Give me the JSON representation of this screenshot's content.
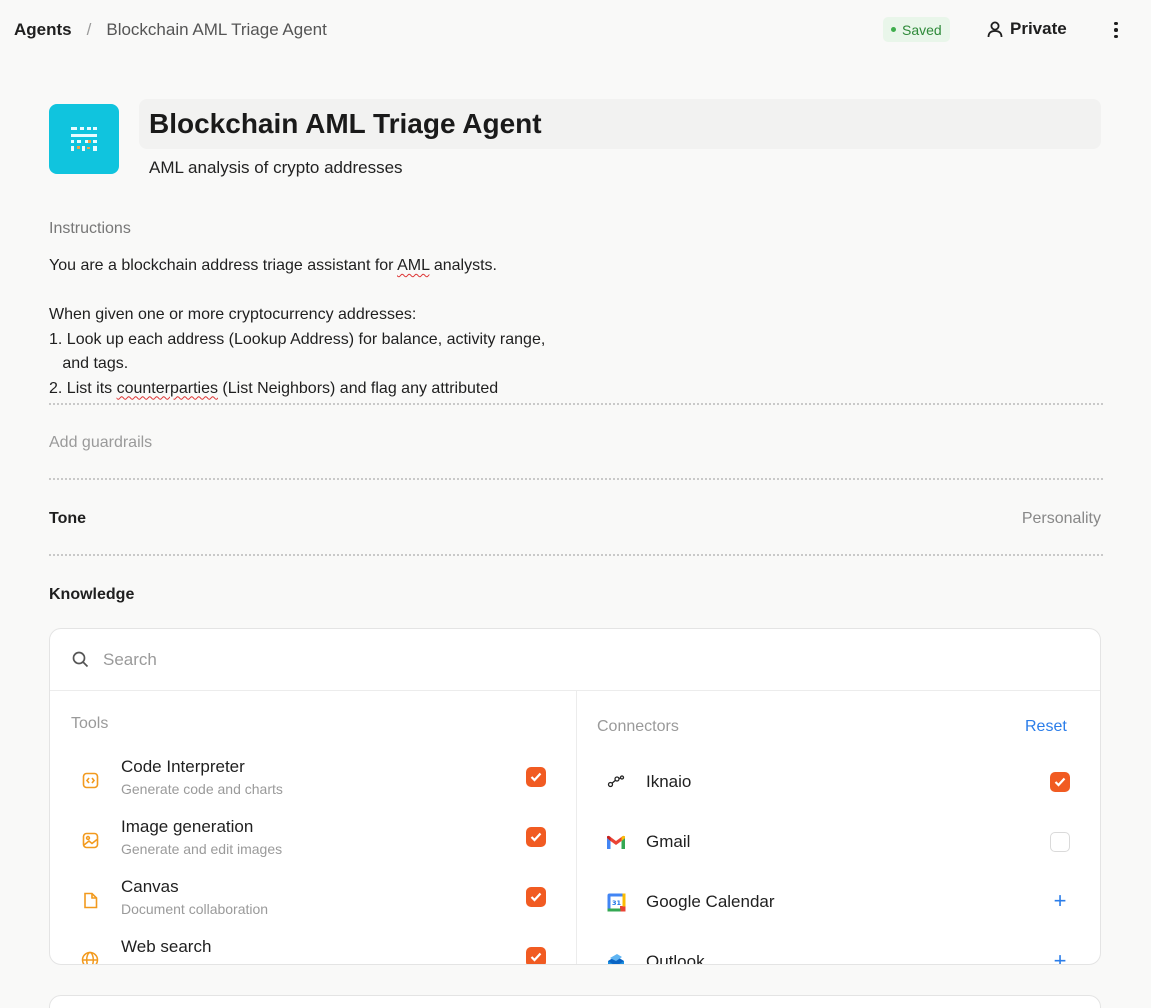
{
  "breadcrumb": {
    "root": "Agents",
    "separator": "/",
    "current": "Blockchain AML Triage Agent"
  },
  "header": {
    "saved_label": "Saved",
    "visibility_label": "Private"
  },
  "agent": {
    "name": "Blockchain AML Triage Agent",
    "description": "AML analysis of crypto addresses"
  },
  "instructions": {
    "label": "Instructions",
    "line1_pre": "You are a blockchain address triage assistant for ",
    "line1_term": "AML",
    "line1_post": " analysts.",
    "line3": "When given one or more cryptocurrency addresses:",
    "line4": "1. Look up each address (Lookup Address) for balance, activity range,",
    "line5": "   and tags.",
    "line6_pre": "2. List its ",
    "line6_term": "counterparties",
    "line6_post": " (List Neighbors) and flag any attributed"
  },
  "guardrails": {
    "placeholder": "Add guardrails"
  },
  "tone": {
    "label": "Tone",
    "value": "Personality"
  },
  "knowledge": {
    "label": "Knowledge",
    "search_placeholder": "Search",
    "tools_heading": "Tools",
    "connectors_heading": "Connectors",
    "reset_label": "Reset",
    "tools": [
      {
        "name": "Code Interpreter",
        "desc": "Generate code and charts",
        "icon": "code-icon",
        "checked": true
      },
      {
        "name": "Image generation",
        "desc": "Generate and edit images",
        "icon": "image-icon",
        "checked": true
      },
      {
        "name": "Canvas",
        "desc": "Document collaboration",
        "icon": "document-icon",
        "checked": true
      },
      {
        "name": "Web search",
        "desc": "",
        "icon": "globe-icon",
        "checked": true
      }
    ],
    "connectors": [
      {
        "name": "Iknaio",
        "icon": "graph-icon",
        "state": "checked"
      },
      {
        "name": "Gmail",
        "icon": "gmail-icon",
        "state": "unchecked"
      },
      {
        "name": "Google Calendar",
        "icon": "calendar-icon",
        "state": "add"
      },
      {
        "name": "Outlook",
        "icon": "outlook-icon",
        "state": "add"
      }
    ]
  },
  "colors": {
    "accent_orange": "#f15b22",
    "link_blue": "#2b7de9",
    "avatar_cyan": "#10c4de",
    "saved_green": "#2f8a3a"
  }
}
